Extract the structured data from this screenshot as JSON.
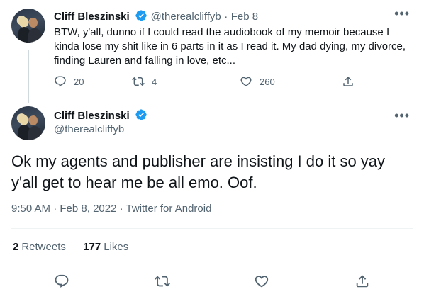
{
  "tweet1": {
    "display_name": "Cliff Bleszinski",
    "handle": "@therealcliffyb",
    "separator": "·",
    "date": "Feb 8",
    "text": "BTW, y'all, dunno if I could read the audiobook of my memoir because I kinda lose my shit like in 6 parts in it as I read it. My dad dying, my divorce, finding Lauren and falling in love, etc...",
    "replies": "20",
    "retweets": "4",
    "likes": "260",
    "more_icon": "more-horizontal-icon"
  },
  "tweet2": {
    "display_name": "Cliff Bleszinski",
    "handle": "@therealcliffyb",
    "text": "Ok my agents and publisher are insisting I do it so yay y'all get to hear me be all emo. Oof.",
    "time": "9:50 AM",
    "date": "Feb 8, 2022",
    "separator": "·",
    "source": "Twitter for Android",
    "retweet_count": "2",
    "retweet_label": "Retweets",
    "like_count": "177",
    "like_label": "Likes",
    "more_icon": "more-horizontal-icon"
  },
  "colors": {
    "text_primary": "#0f1419",
    "text_secondary": "#536471",
    "verified_blue": "#1d9bf0",
    "divider": "#eff3f4",
    "thread_line": "#cfd9de"
  }
}
